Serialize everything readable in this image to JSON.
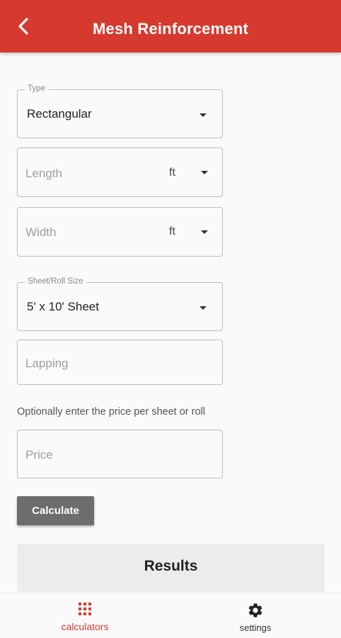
{
  "header": {
    "title": "Mesh Reinforcement",
    "back_icon": "back-arrow-icon",
    "background_color": "#d63a2f"
  },
  "form": {
    "type": {
      "label": "Type",
      "value": "Rectangular"
    },
    "length": {
      "placeholder": "Length",
      "unit": "ft"
    },
    "width": {
      "placeholder": "Width",
      "unit": "ft"
    },
    "sheet_size": {
      "label": "Sheet/Roll Size",
      "value": "5' x 10' Sheet"
    },
    "lapping": {
      "placeholder": "Lapping"
    },
    "price_hint": "Optionally enter the price per sheet or roll",
    "price": {
      "placeholder": "Price"
    },
    "calculate_label": "Calculate"
  },
  "results": {
    "title": "Results"
  },
  "bottom_nav": {
    "items": [
      {
        "label": "calculators",
        "icon": "grid-icon",
        "active": true
      },
      {
        "label": "settings",
        "icon": "gear-icon",
        "active": false
      }
    ],
    "active_color": "#d63a2f"
  }
}
